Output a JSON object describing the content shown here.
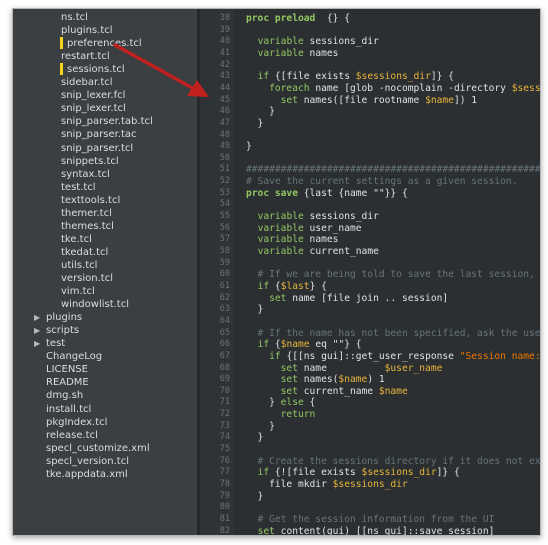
{
  "sidebar": {
    "items": [
      {
        "label": "ns.tcl",
        "indent": 2
      },
      {
        "label": "plugins.tcl",
        "indent": 2
      },
      {
        "label": "preferences.tcl",
        "indent": 2,
        "marked": true
      },
      {
        "label": "restart.tcl",
        "indent": 2
      },
      {
        "label": "sessions.tcl",
        "indent": 2,
        "marked": true
      },
      {
        "label": "sidebar.tcl",
        "indent": 2
      },
      {
        "label": "snip_lexer.fcl",
        "indent": 2
      },
      {
        "label": "snip_lexer.tcl",
        "indent": 2
      },
      {
        "label": "snip_parser.tab.tcl",
        "indent": 2
      },
      {
        "label": "snip_parser.tac",
        "indent": 2
      },
      {
        "label": "snip_parser.tcl",
        "indent": 2
      },
      {
        "label": "snippets.tcl",
        "indent": 2
      },
      {
        "label": "syntax.tcl",
        "indent": 2
      },
      {
        "label": "test.tcl",
        "indent": 2
      },
      {
        "label": "texttools.tcl",
        "indent": 2
      },
      {
        "label": "themer.tcl",
        "indent": 2
      },
      {
        "label": "themes.tcl",
        "indent": 2
      },
      {
        "label": "tke.tcl",
        "indent": 2
      },
      {
        "label": "tkedat.tcl",
        "indent": 2
      },
      {
        "label": "utils.tcl",
        "indent": 2
      },
      {
        "label": "version.tcl",
        "indent": 2
      },
      {
        "label": "vim.tcl",
        "indent": 2
      },
      {
        "label": "windowlist.tcl",
        "indent": 2
      },
      {
        "label": "plugins",
        "indent": 1,
        "folder": true
      },
      {
        "label": "scripts",
        "indent": 1,
        "folder": true
      },
      {
        "label": "test",
        "indent": 1,
        "folder": true
      },
      {
        "label": "ChangeLog",
        "indent": 1
      },
      {
        "label": "LICENSE",
        "indent": 1
      },
      {
        "label": "README",
        "indent": 1
      },
      {
        "label": "dmg.sh",
        "indent": 1
      },
      {
        "label": "install.tcl",
        "indent": 1
      },
      {
        "label": "pkgIndex.tcl",
        "indent": 1
      },
      {
        "label": "release.tcl",
        "indent": 1
      },
      {
        "label": "specl_customize.xml",
        "indent": 1
      },
      {
        "label": "specl_version.tcl",
        "indent": 1
      },
      {
        "label": "tke.appdata.xml",
        "indent": 1
      }
    ],
    "folder_icon": "triangle-right-icon"
  },
  "editor": {
    "first_line": 38,
    "lines": [
      [
        [
          "kb",
          "proc preload"
        ],
        [
          "",
          "  {} {"
        ]
      ],
      [
        [
          "",
          ""
        ]
      ],
      [
        [
          "",
          "  "
        ],
        [
          "kw",
          "variable"
        ],
        [
          "",
          " sessions_dir"
        ]
      ],
      [
        [
          "",
          "  "
        ],
        [
          "kw",
          "variable"
        ],
        [
          "",
          " names"
        ]
      ],
      [
        [
          "",
          ""
        ]
      ],
      [
        [
          "",
          "  "
        ],
        [
          "kw",
          "if"
        ],
        [
          "",
          " {[file exists "
        ],
        [
          "vr",
          "$sessions_dir"
        ],
        [
          "",
          "]} {"
        ]
      ],
      [
        [
          "",
          "    "
        ],
        [
          "kw",
          "foreach"
        ],
        [
          "",
          " name [glob -nocomplain -directory "
        ],
        [
          "vr",
          "$sessions_"
        ]
      ],
      [
        [
          "",
          "      "
        ],
        [
          "kw",
          "set"
        ],
        [
          "",
          " names([file rootname "
        ],
        [
          "vr",
          "$name"
        ],
        [
          "",
          "]) 1"
        ]
      ],
      [
        [
          "",
          "    }"
        ]
      ],
      [
        [
          "",
          "  }"
        ]
      ],
      [
        [
          "",
          ""
        ]
      ],
      [
        [
          "",
          "}"
        ]
      ],
      [
        [
          "",
          ""
        ]
      ],
      [
        [
          "cm",
          "######################################################################"
        ]
      ],
      [
        [
          "cm",
          "# Save the current settings as a given session."
        ]
      ],
      [
        [
          "kb",
          "proc save"
        ],
        [
          "",
          " {last {name \"\"}} {"
        ]
      ],
      [
        [
          "",
          ""
        ]
      ],
      [
        [
          "",
          "  "
        ],
        [
          "kw",
          "variable"
        ],
        [
          "",
          " sessions_dir"
        ]
      ],
      [
        [
          "",
          "  "
        ],
        [
          "kw",
          "variable"
        ],
        [
          "",
          " user_name"
        ]
      ],
      [
        [
          "",
          "  "
        ],
        [
          "kw",
          "variable"
        ],
        [
          "",
          " names"
        ]
      ],
      [
        [
          "",
          "  "
        ],
        [
          "kw",
          "variable"
        ],
        [
          "",
          " current_name"
        ]
      ],
      [
        [
          "",
          ""
        ]
      ],
      [
        [
          "cm",
          "  # If we are being told to save the last session, set t"
        ]
      ],
      [
        [
          "",
          "  "
        ],
        [
          "kw",
          "if"
        ],
        [
          "",
          " {"
        ],
        [
          "vr",
          "$last"
        ],
        [
          "",
          "} {"
        ]
      ],
      [
        [
          "",
          "    "
        ],
        [
          "kw",
          "set"
        ],
        [
          "",
          " name [file join .. session]"
        ]
      ],
      [
        [
          "",
          "  }"
        ]
      ],
      [
        [
          "",
          ""
        ]
      ],
      [
        [
          "cm",
          "  # If the name has not been specified, ask the user for"
        ]
      ],
      [
        [
          "",
          "  "
        ],
        [
          "kw",
          "if"
        ],
        [
          "",
          " {"
        ],
        [
          "vr",
          "$name"
        ],
        [
          "",
          " eq \"\"} {"
        ]
      ],
      [
        [
          "",
          "    "
        ],
        [
          "kw",
          "if"
        ],
        [
          "",
          " {[[ns gui]::get_user_response "
        ],
        [
          "st",
          "\"Session name:\""
        ],
        [
          "",
          " ses"
        ]
      ],
      [
        [
          "",
          "      "
        ],
        [
          "kw",
          "set"
        ],
        [
          "",
          " name          "
        ],
        [
          "vr",
          "$user_name"
        ]
      ],
      [
        [
          "",
          "      "
        ],
        [
          "kw",
          "set"
        ],
        [
          "",
          " names("
        ],
        [
          "vr",
          "$name"
        ],
        [
          "",
          ") 1"
        ]
      ],
      [
        [
          "",
          "      "
        ],
        [
          "kw",
          "set"
        ],
        [
          "",
          " current_name "
        ],
        [
          "vr",
          "$name"
        ]
      ],
      [
        [
          "",
          "    } "
        ],
        [
          "kw",
          "else"
        ],
        [
          "",
          " {"
        ]
      ],
      [
        [
          "",
          "      "
        ],
        [
          "kw",
          "return"
        ]
      ],
      [
        [
          "",
          "    }"
        ]
      ],
      [
        [
          "",
          "  }"
        ]
      ],
      [
        [
          "",
          ""
        ]
      ],
      [
        [
          "cm",
          "  # Create the sessions directory if it does not exist"
        ]
      ],
      [
        [
          "",
          "  "
        ],
        [
          "kw",
          "if"
        ],
        [
          "",
          " {![file exists "
        ],
        [
          "vr",
          "$sessions_dir"
        ],
        [
          "",
          "]} {"
        ]
      ],
      [
        [
          "",
          "    file mkdir "
        ],
        [
          "vr",
          "$sessions_dir"
        ]
      ],
      [
        [
          "",
          "  }"
        ]
      ],
      [
        [
          "",
          ""
        ]
      ],
      [
        [
          "cm",
          "  # Get the session information from the UI"
        ]
      ],
      [
        [
          "",
          "  "
        ],
        [
          "kw",
          "set"
        ],
        [
          "",
          " content(gui) [[ns gui]::save_session]"
        ]
      ]
    ]
  },
  "annotation": {
    "color": "#c0201e",
    "icon": "red-arrow-pointer"
  },
  "colors": {
    "sidebar_bg": "#3b3f42",
    "editor_bg": "#2b2f31",
    "gutter_bg": "#2f3335",
    "mark": "#f4d31b",
    "keyword": "#93c763",
    "variable": "#e8b53a",
    "comment": "#66747b",
    "string": "#ec7600"
  }
}
